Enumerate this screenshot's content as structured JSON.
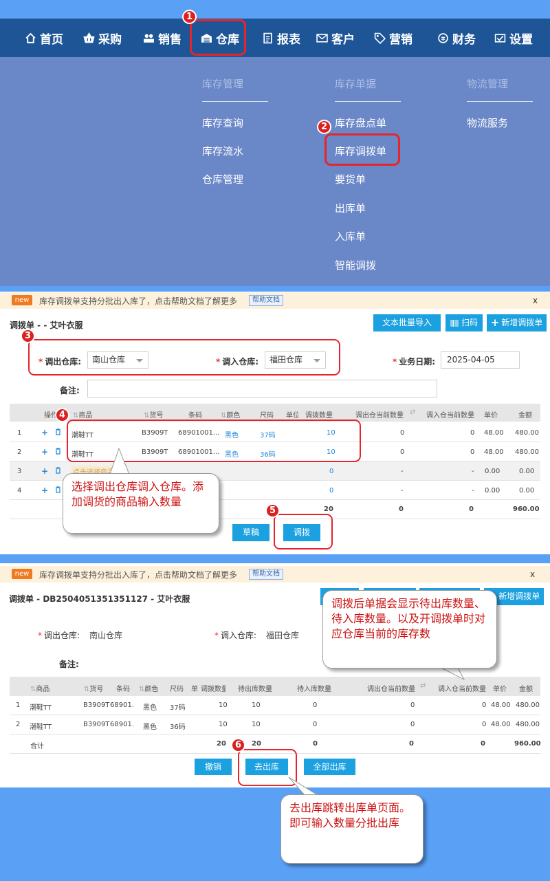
{
  "nav": {
    "items": [
      {
        "label": "首页",
        "icon": "home-icon"
      },
      {
        "label": "采购",
        "icon": "basket-icon"
      },
      {
        "label": "销售",
        "icon": "users-icon"
      },
      {
        "label": "仓库",
        "icon": "warehouse-icon"
      },
      {
        "label": "报表",
        "icon": "report-icon"
      },
      {
        "label": "客户",
        "icon": "mail-icon"
      },
      {
        "label": "营销",
        "icon": "tag-icon"
      },
      {
        "label": "财务",
        "icon": "finance-icon"
      },
      {
        "label": "设置",
        "icon": "settings-icon"
      }
    ]
  },
  "dropdown": {
    "groups": [
      {
        "title": "库存管理",
        "items": [
          "库存查询",
          "库存流水",
          "仓库管理"
        ]
      },
      {
        "title": "库存单据",
        "items": [
          "库存盘点单",
          "库存调拨单",
          "要货单",
          "出库单",
          "入库单",
          "智能调拨"
        ]
      },
      {
        "title": "物流管理",
        "items": [
          "物流服务"
        ]
      }
    ]
  },
  "banner": {
    "badge": "new",
    "text": "库存调拨单支持分批出入库了，点击帮助文档了解更多",
    "help": "帮助文档",
    "close": "x"
  },
  "form": {
    "title": "调拨单 - - 艾叶衣服",
    "buttons": {
      "bulk_import": "文本批量导入",
      "scan": "扫码",
      "new": "新增调拨单"
    },
    "out_label": "调出仓库:",
    "out_value": "南山仓库",
    "in_label": "调入仓库:",
    "in_value": "福田仓库",
    "date_label": "业务日期:",
    "date_value": "2025-04-05",
    "remark_label": "备注:",
    "columns": [
      "操作",
      "商品",
      "货号",
      "条码",
      "颜色",
      "尺码",
      "单位",
      "调拨数量",
      "调出仓当前数量",
      "调入仓当前数量",
      "单价",
      "金额"
    ],
    "rows": [
      {
        "no": "1",
        "product": "潮鞋TT",
        "sku": "B3909T",
        "barcode": "68901001...",
        "color": "黑色",
        "size": "37码",
        "qty": "10",
        "out_stock": "0",
        "in_stock": "0",
        "price": "48.00",
        "amount": "480.00"
      },
      {
        "no": "2",
        "product": "潮鞋TT",
        "sku": "B3909T",
        "barcode": "68901001...",
        "color": "黑色",
        "size": "36码",
        "qty": "10",
        "out_stock": "0",
        "in_stock": "0",
        "price": "48.00",
        "amount": "480.00"
      },
      {
        "no": "3",
        "product": "点击选择商品",
        "qty": "0",
        "out_stock": "-",
        "in_stock": "-",
        "price": "0.00",
        "amount": "0.00"
      },
      {
        "no": "4",
        "qty": "0",
        "out_stock": "-",
        "in_stock": "-",
        "price": "0.00",
        "amount": "0.00"
      }
    ],
    "totals": {
      "qty": "20",
      "out_stock": "0",
      "in_stock": "0",
      "amount": "960.00"
    },
    "draft_button": "草稿",
    "submit_button": "调拨"
  },
  "detail": {
    "title": "调拨单 - DB2504051351351127 - 艾叶衣服",
    "new_button": "新增调拨单",
    "out_label": "调出仓库:",
    "out_value": "南山仓库",
    "in_label": "调入仓库:",
    "in_value": "福田仓库",
    "remark_label": "备注:",
    "columns": [
      "商品",
      "货号",
      "条码",
      "颜色",
      "尺码",
      "单",
      "调拨数量",
      "待出库数量",
      "待入库数量",
      "调出仓当前数量",
      "调入仓当前数量",
      "单价",
      "金额"
    ],
    "rows": [
      {
        "no": "1",
        "product": "潮鞋TT",
        "sku": "B3909T",
        "barcode": "68901...",
        "color": "黑色",
        "size": "37码",
        "qty": "10",
        "pending_out": "10",
        "pending_in": "0",
        "out_stock": "0",
        "in_stock": "0",
        "price": "48.00",
        "amount": "480.00"
      },
      {
        "no": "2",
        "product": "潮鞋TT",
        "sku": "B3909T",
        "barcode": "68901...",
        "color": "黑色",
        "size": "36码",
        "qty": "10",
        "pending_out": "10",
        "pending_in": "0",
        "out_stock": "0",
        "in_stock": "0",
        "price": "48.00",
        "amount": "480.00"
      }
    ],
    "totals": {
      "label": "合计",
      "qty": "20",
      "pending_out": "20",
      "pending_in": "0",
      "out_stock": "0",
      "in_stock": "0",
      "amount": "960.00"
    },
    "cancel_button": "撤销",
    "out_button": "去出库",
    "all_out_button": "全部出库"
  },
  "callouts": {
    "c1": "选择调出仓库调入仓库。添加调货的商品输入数量",
    "c2": "调拨后单据会显示待出库数量、待入库数量。以及开调拨单时对应仓库当前的库存数",
    "c3": "去出库跳转出库单页面。即可输入数量分批出库"
  },
  "steps": [
    "1",
    "2",
    "3",
    "4",
    "5",
    "6"
  ],
  "colors": {
    "nav": "#1d5597",
    "dropdown": "#6a87c7",
    "accent": "#1ba0e0",
    "annotation": "#e6252b",
    "background": "#5aa0f5"
  }
}
